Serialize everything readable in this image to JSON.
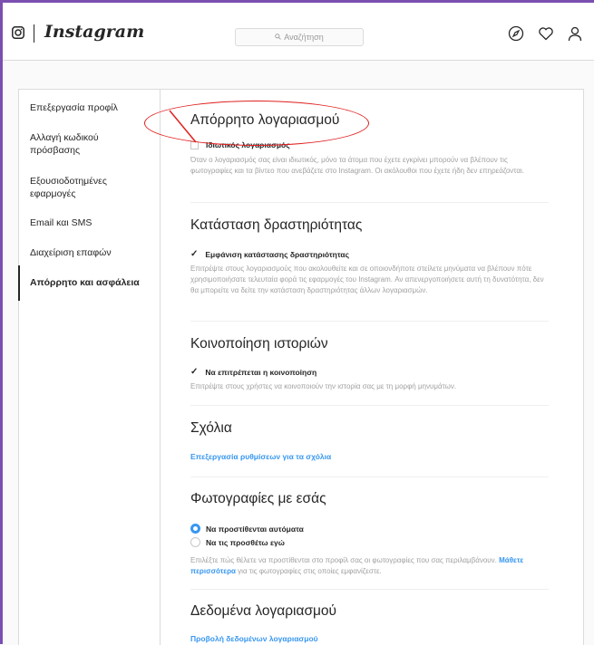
{
  "header": {
    "logo_text": "Instagram",
    "search_placeholder": "Αναζήτηση",
    "icons": [
      "instagram-glyph-icon",
      "explore-compass-icon",
      "heart-icon",
      "profile-icon"
    ]
  },
  "sidebar": {
    "items": [
      {
        "label": "Επεξεργασία προφίλ",
        "active": false
      },
      {
        "label": "Αλλαγή κωδικού πρόσβασης",
        "active": false
      },
      {
        "label": "Εξουσιοδοτημένες εφαρμογές",
        "active": false
      },
      {
        "label": "Email και SMS",
        "active": false
      },
      {
        "label": "Διαχείριση επαφών",
        "active": false
      },
      {
        "label": "Απόρρητο και ασφάλεια",
        "active": true
      }
    ]
  },
  "sections": {
    "privacy": {
      "title": "Απόρρητο λογαριασμού",
      "option_label": "Ιδιωτικός λογαριασμός",
      "checked": false,
      "description": "Όταν ο λογαριασμός σας είναι ιδιωτικός, μόνο τα άτομα που έχετε εγκρίνει μπορούν να βλέπουν τις φωτογραφίες και τα βίντεο που ανεβάζετε στο Instagram. Οι ακόλουθοι που έχετε ήδη δεν επηρεάζονται."
    },
    "activity": {
      "title": "Κατάσταση δραστηριότητας",
      "option_label": "Εμφάνιση κατάστασης δραστηριότητας",
      "checked": true,
      "description": "Επιτρέψτε στους λογαριασμούς που ακολουθείτε και σε οποιονδήποτε στείλετε μηνύματα να βλέπουν πότε χρησιμοποιήσατε τελευταία φορά τις εφαρμογές του Instagram. Αν απενεργοποιήσετε αυτή τη δυνατότητα, δεν θα μπορείτε να δείτε την κατάσταση δραστηριότητας άλλων λογαριασμών."
    },
    "story_sharing": {
      "title": "Κοινοποίηση ιστοριών",
      "option_label": "Να επιτρέπεται η κοινοποίηση",
      "checked": true,
      "description": "Επιτρέψτε στους χρήστες να κοινοποιούν την ιστορία σας με τη μορφή μηνυμάτων."
    },
    "comments": {
      "title": "Σχόλια",
      "link": "Επεξεργασία ρυθμίσεων για τα σχόλια"
    },
    "photos_of_you": {
      "title": "Φωτογραφίες με εσάς",
      "options": [
        {
          "label": "Να προστίθενται αυτόματα",
          "selected": true
        },
        {
          "label": "Να τις προσθέτω εγώ",
          "selected": false
        }
      ],
      "description_before": "Επιλέξτε πώς θέλετε να προστίθενται στο προφίλ σας οι φωτογραφίες που σας περιλαμβάνουν.",
      "description_link": "Μάθετε περισσότερα",
      "description_after": "για τις φωτογραφίες στις οποίες εμφανίζεστε."
    },
    "account_data": {
      "title": "Δεδομένα λογαριασμού",
      "link": "Προβολή δεδομένων λογαριασμού"
    }
  },
  "colors": {
    "accent": "#3897f0",
    "annotation": "#e02020",
    "frame": "#7b4fb0"
  }
}
